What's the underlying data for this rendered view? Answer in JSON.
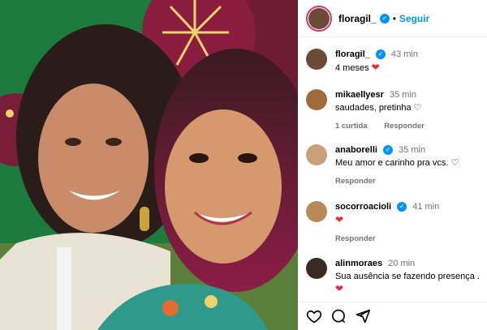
{
  "post": {
    "username": "floragil_",
    "follow_label": "Seguir",
    "separator": "•"
  },
  "comments": [
    {
      "username": "floragil_",
      "verified": true,
      "time": "43 min",
      "text": "4 meses",
      "emoji": "❤",
      "likes": "",
      "reply": ""
    },
    {
      "username": "mikaellyesr",
      "verified": false,
      "time": "35 min",
      "text": "saudades, pretinha",
      "emoji": "♡",
      "likes": "1 curtida",
      "reply": "Responder"
    },
    {
      "username": "anaborelli",
      "verified": true,
      "time": "35 min",
      "text": "Meu amor e carinho pra vcs.",
      "emoji": "♡",
      "likes": "",
      "reply": "Responder"
    },
    {
      "username": "socorroacioli",
      "verified": true,
      "time": "41 min",
      "text": "",
      "emoji": "❤",
      "likes": "",
      "reply": "Responder"
    },
    {
      "username": "alinmoraes",
      "verified": false,
      "time": "20 min",
      "text": "Sua ausência se fazendo presença .",
      "emoji": "❤",
      "likes": "",
      "reply": ""
    }
  ],
  "icons": {
    "like": "heart-outline-icon",
    "comment": "comment-bubble-icon",
    "share": "paper-plane-icon",
    "verified": "verified-badge-icon"
  },
  "colors": {
    "accent": "#0095f6",
    "heart": "#ed2b3c",
    "muted": "#737373"
  }
}
